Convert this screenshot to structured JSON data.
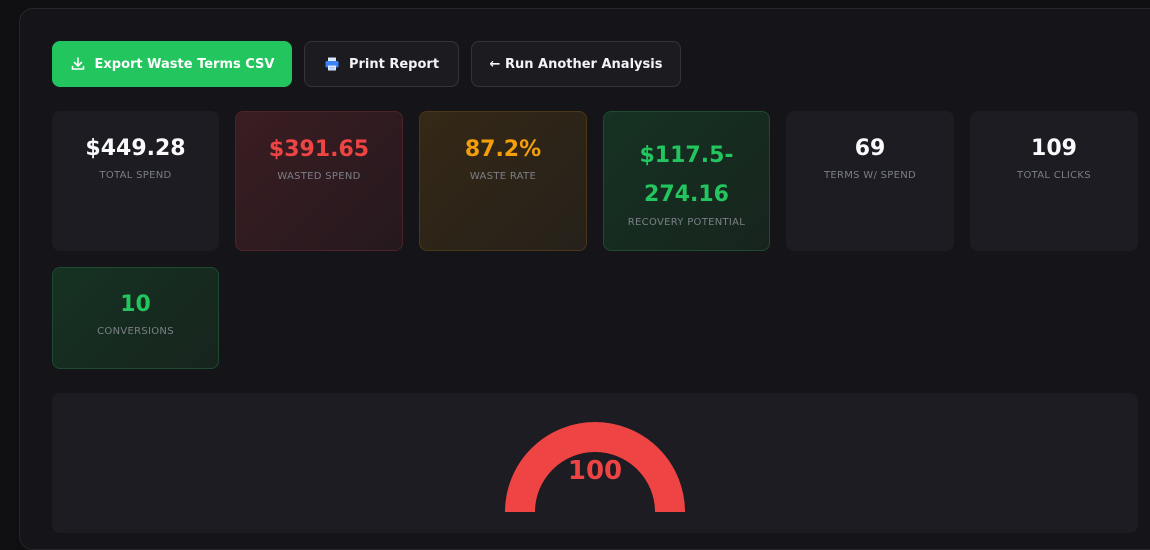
{
  "actions": {
    "export_label": "Export Waste Terms CSV",
    "print_label": "Print Report",
    "run_label": "← Run Another Analysis"
  },
  "stats": {
    "total_spend": {
      "value": "$449.28",
      "label": "TOTAL SPEND"
    },
    "wasted_spend": {
      "value": "$391.65",
      "label": "WASTED SPEND"
    },
    "waste_rate": {
      "value": "87.2%",
      "label": "WASTE RATE"
    },
    "recovery_potential": {
      "value_line1": "$117.5-",
      "value_line2": "274.16",
      "label": "RECOVERY POTENTIAL"
    },
    "terms_with_spend": {
      "value": "69",
      "label": "TERMS W/ SPEND"
    },
    "total_clicks": {
      "value": "109",
      "label": "TOTAL CLICKS"
    },
    "conversions": {
      "value": "10",
      "label": "CONVERSIONS"
    }
  },
  "gauge": {
    "value": "100",
    "fill_fraction": 1.0,
    "color": "#ef4444"
  },
  "colors": {
    "accent_green": "#22c55e",
    "danger_red": "#ef4444",
    "warning_orange": "#f59e0b",
    "background": "#0f0f12"
  },
  "icons": {
    "export": "download-icon",
    "print": "printer-icon"
  }
}
